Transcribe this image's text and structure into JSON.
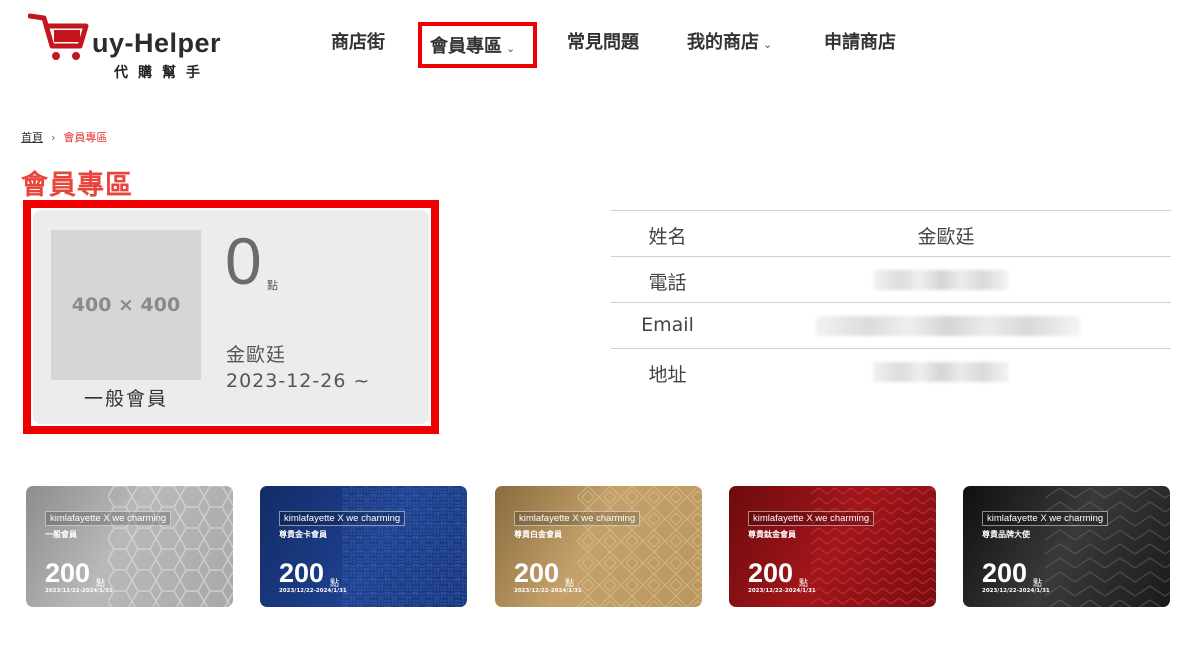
{
  "header": {
    "logo_text": "uy-Helper",
    "logo_sub": "代購幫手",
    "nav": [
      {
        "label": "商店街",
        "dropdown": false
      },
      {
        "label": "會員專區",
        "dropdown": true,
        "active": true
      },
      {
        "label": "常見問題",
        "dropdown": false
      },
      {
        "label": "我的商店",
        "dropdown": true
      },
      {
        "label": "申請商店",
        "dropdown": false
      }
    ]
  },
  "breadcrumb": {
    "home": "首頁",
    "separator": "›",
    "current": "會員專區"
  },
  "page_title": "會員專區",
  "member": {
    "avatar_placeholder": "400 × 400",
    "level": "一般會員",
    "points": "0",
    "points_unit": "點",
    "name": "金歐廷",
    "since": "2023-12-26 ~"
  },
  "info": {
    "name_label": "姓名",
    "name_value": "金歐廷",
    "phone_label": "電話",
    "email_label": "Email",
    "address_label": "地址"
  },
  "tiers": [
    {
      "brand": "kimlafayette X we charming",
      "name": "一般會員",
      "points": "200",
      "unit": "點",
      "period": "2023/12/22-2024/1/31",
      "color": "#9e9e9e"
    },
    {
      "brand": "kimlafayette X we charming",
      "name": "尊貴金卡會員",
      "points": "200",
      "unit": "點",
      "period": "2023/12/22-2024/1/31",
      "color": "#1d3e86"
    },
    {
      "brand": "kimlafayette X we charming",
      "name": "尊貴白金會員",
      "points": "200",
      "unit": "點",
      "period": "2023/12/22-2024/1/31",
      "color": "#b08d5a"
    },
    {
      "brand": "kimlafayette X we charming",
      "name": "尊貴鈦金會員",
      "points": "200",
      "unit": "點",
      "period": "2023/12/22-2024/1/31",
      "color": "#8e1115"
    },
    {
      "brand": "kimlafayette X we charming",
      "name": "尊貴品牌大使",
      "points": "200",
      "unit": "點",
      "period": "2023/12/22-2024/1/31",
      "color": "#1e1e1e"
    }
  ],
  "colors": {
    "accent": "#e8453c",
    "highlight": "#ee0000"
  }
}
